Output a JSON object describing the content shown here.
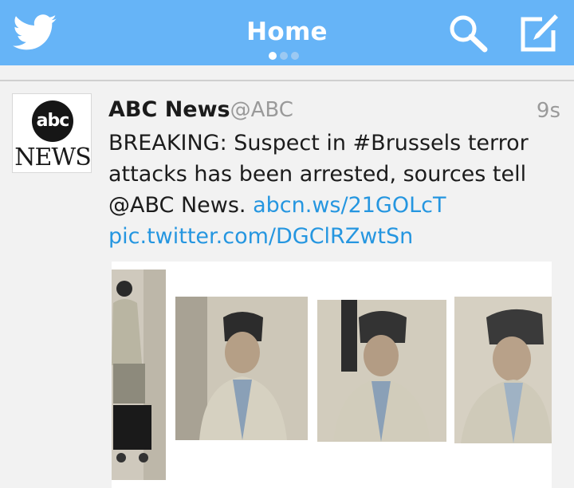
{
  "header": {
    "title": "Home",
    "page_dots": 3,
    "active_dot": 0,
    "icons": [
      "twitter-bird-icon",
      "search-icon",
      "compose-icon"
    ],
    "bar_color": "#66b4f7"
  },
  "tweet": {
    "avatar_text_top": "abc",
    "avatar_text_bottom": "NEWS",
    "author_name": "ABC News",
    "author_handle": "@ABC",
    "timestamp": "9s",
    "text_main": "BREAKING: Suspect in #Brussels terror attacks has been arrested, sources tell @ABC News.",
    "link_1": "abcn.ws/21GOLcT",
    "link_2": "pic.twitter.com/DGClRZwtSn",
    "link_color": "#2596e0"
  }
}
